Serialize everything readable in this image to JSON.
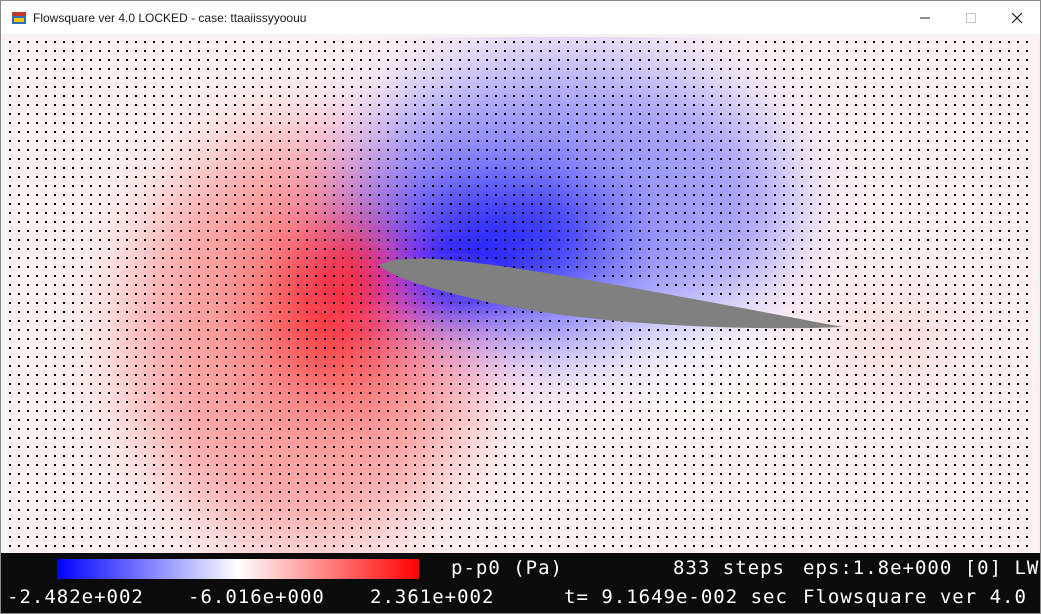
{
  "window": {
    "title": "Flowsquare ver 4.0 LOCKED - case: ttaaiissyyoouu",
    "controls": [
      "minimize-icon",
      "maximize-icon",
      "close-icon"
    ]
  },
  "visualization": {
    "field": "p-p0 (Pa)",
    "colormap": {
      "low": "#0000ff",
      "mid": "#ffffff",
      "high": "#ff0000"
    },
    "object_color": "#808080",
    "vector_color": "#000000"
  },
  "status": {
    "variable": "p-p0 (Pa)",
    "steps": "833 steps",
    "eps": "eps:1.8e+000 [0] LW",
    "colorbar_min": "-2.482e+002",
    "colorbar_mid": "-6.016e+000",
    "colorbar_max": "2.361e+002",
    "time": "t= 9.1649e-002 sec",
    "app_name": "Flowsquare ver 4.0 L"
  }
}
